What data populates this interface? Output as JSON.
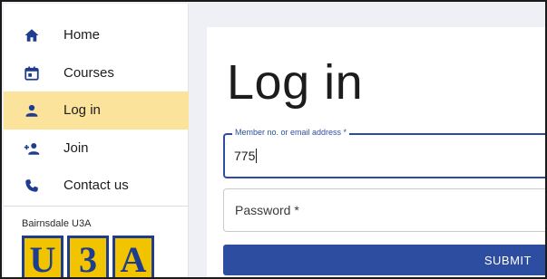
{
  "sidebar": {
    "items": [
      {
        "label": "Home",
        "icon": "home-icon"
      },
      {
        "label": "Courses",
        "icon": "calendar-icon"
      },
      {
        "label": "Log in",
        "icon": "person-icon",
        "active": true
      },
      {
        "label": "Join",
        "icon": "person-add-icon"
      },
      {
        "label": "Contact us",
        "icon": "phone-icon"
      }
    ],
    "org_name": "Bairnsdale U3A",
    "logo_letters": [
      "U",
      "3",
      "A"
    ]
  },
  "main": {
    "title": "Log in",
    "member_field": {
      "label": "Member no. or email address *",
      "value": "775"
    },
    "password_field": {
      "placeholder": "Password *"
    },
    "submit_label": "SUBMIT"
  },
  "colors": {
    "accent": "#2d4ea0",
    "active_nav_bg": "#fbe39b",
    "logo_yellow": "#f2c400",
    "logo_blue": "#1f3d8f",
    "page_bg": "#eef0f5"
  }
}
